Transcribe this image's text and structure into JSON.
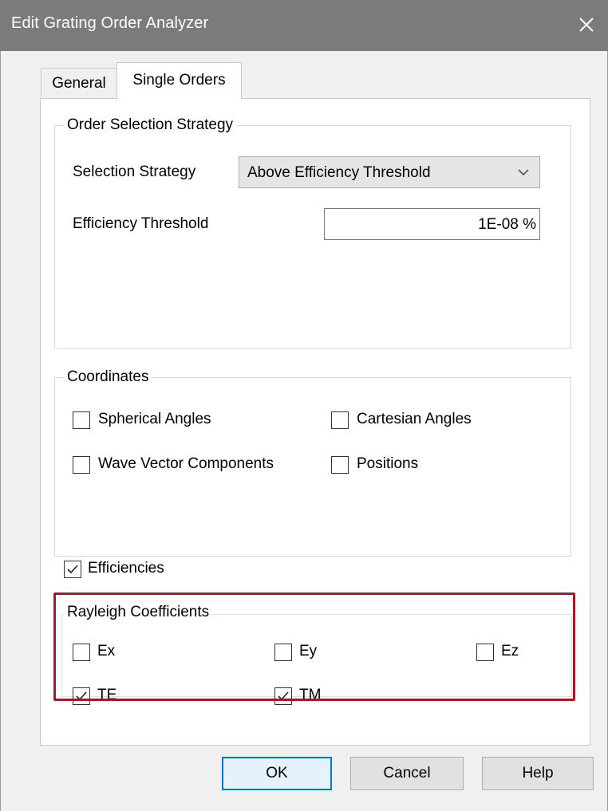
{
  "window": {
    "title": "Edit Grating Order Analyzer",
    "close_icon": "close-icon"
  },
  "tabs": [
    {
      "label": "General",
      "selected": false
    },
    {
      "label": "Single Orders",
      "selected": true
    }
  ],
  "order_selection": {
    "group_label": "Order Selection Strategy",
    "strategy_label": "Selection Strategy",
    "strategy_value": "Above Efficiency Threshold",
    "threshold_label": "Efficiency Threshold",
    "threshold_value": "1E-08 %"
  },
  "coordinates": {
    "group_label": "Coordinates",
    "options": [
      {
        "label": "Spherical Angles",
        "checked": false
      },
      {
        "label": "Cartesian Angles",
        "checked": false
      },
      {
        "label": "Wave Vector Components",
        "checked": false
      },
      {
        "label": "Positions",
        "checked": false
      }
    ]
  },
  "efficiencies": {
    "label": "Efficiencies",
    "checked": true
  },
  "rayleigh": {
    "group_label": "Rayleigh Coefficients",
    "options": [
      {
        "label": "Ex",
        "checked": false
      },
      {
        "label": "Ey",
        "checked": false
      },
      {
        "label": "Ez",
        "checked": false
      },
      {
        "label": "TE",
        "checked": true
      },
      {
        "label": "TM",
        "checked": true
      }
    ],
    "highlight_color": "#a31a23"
  },
  "buttons": {
    "ok": "OK",
    "cancel": "Cancel",
    "help": "Help"
  },
  "colors": {
    "titlebar": "#7b7b7b",
    "dialog_bg": "#f0f0f0",
    "panel_bg": "#ffffff",
    "default_button_border": "#0078d7"
  }
}
